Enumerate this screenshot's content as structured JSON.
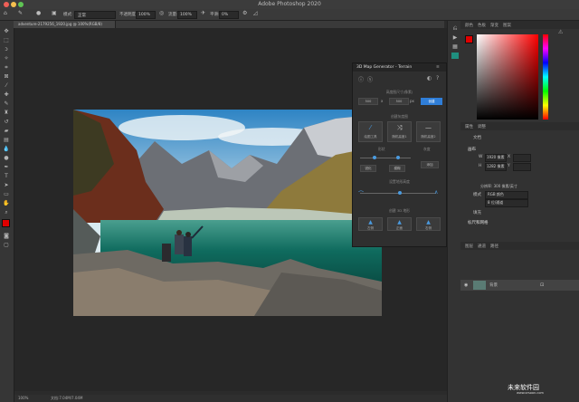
{
  "app": {
    "title": "Adobe Photoshop 2020"
  },
  "options_bar": {
    "mode_label": "模式:",
    "mode_value": "正常",
    "opacity_label": "不透明度:",
    "opacity_value": "100%",
    "flow_label": "流量:",
    "flow_value": "100%",
    "smoothing_label": "平滑:",
    "smoothing_value": "0%"
  },
  "document": {
    "tab_title": "adventure-2179256_1920.jpg @ 100%(RGB/8)"
  },
  "status": {
    "zoom": "100%",
    "doc_info": "文档:7.04M/7.04M"
  },
  "color_panel": {
    "tabs": [
      "颜色",
      "色板",
      "渐变",
      "图案"
    ],
    "foreground": "#e00000",
    "background": "#ffffff"
  },
  "plugin": {
    "title": "3D Map Generator - Terrain",
    "section1_label": "高度图尺寸(像素)",
    "width_value": "500",
    "times": "x",
    "height_value": "500",
    "unit": "px",
    "create_button": "创建",
    "section2_label": "创建灰度图",
    "buttons_row": [
      {
        "icon": "brush-icon",
        "label": "绘图工具"
      },
      {
        "icon": "shuffle-icon",
        "label": "随机高度1"
      },
      {
        "icon": "minus-icon",
        "label": "随机高度2"
      }
    ],
    "section3_label": "形状",
    "section3_right": "灰度",
    "btn_sharpen": "锐化",
    "btn_blur": "模糊",
    "btn_add": "添加",
    "section4_label": "设置地形高度",
    "section5_label": "创建 3D 地形",
    "arrows_row": [
      {
        "label": "左侧"
      },
      {
        "label": "正面"
      },
      {
        "label": "右侧"
      }
    ]
  },
  "properties_panel": {
    "tabs": [
      "属性",
      "调整"
    ],
    "doc_label": "文档",
    "canvas_label": "画布",
    "w_label": "W",
    "w_value": "1920 像素",
    "h_label": "H",
    "h_value": "1282 像素",
    "x_label": "X",
    "y_label": "Y",
    "resolution": "分辨率: 300 像素/英寸",
    "mode_label": "模式",
    "mode_value": "RGB 颜色",
    "depth_value": "8 位/通道",
    "fill_label": "填充",
    "guides_label": "标尺和网格"
  },
  "layers_panel": {
    "tabs": [
      "图层",
      "通道",
      "路径"
    ],
    "layer_name": "背景"
  },
  "watermark": {
    "text": "未来软件园",
    "url": "www.orsoon.com"
  }
}
